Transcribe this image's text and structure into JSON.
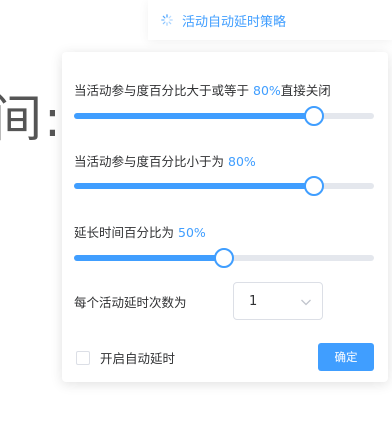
{
  "background": {
    "text": "间:"
  },
  "trigger": {
    "icon": "loading-spinner-icon",
    "label": "活动自动延时策略"
  },
  "popover": {
    "rules": [
      {
        "prefix": "当活动参与度百分比大于或等于",
        "value": "80%",
        "suffix": "直接关闭",
        "percent": 80
      },
      {
        "prefix": "当活动参与度百分比小于为",
        "value": "80%",
        "suffix": "",
        "percent": 80
      },
      {
        "prefix": "延长时间百分比为",
        "value": "50%",
        "suffix": "",
        "percent": 50
      }
    ],
    "delay_count": {
      "label": "每个活动延时次数为",
      "selected": "1",
      "icon": "chevron-down-icon"
    },
    "auto_delay": {
      "label": "开启自动延时",
      "checked": false
    },
    "confirm_label": "确定"
  },
  "colors": {
    "primary": "#409eff",
    "track": "#e4e7ed",
    "text": "#303133",
    "border": "#dcdfe6"
  }
}
